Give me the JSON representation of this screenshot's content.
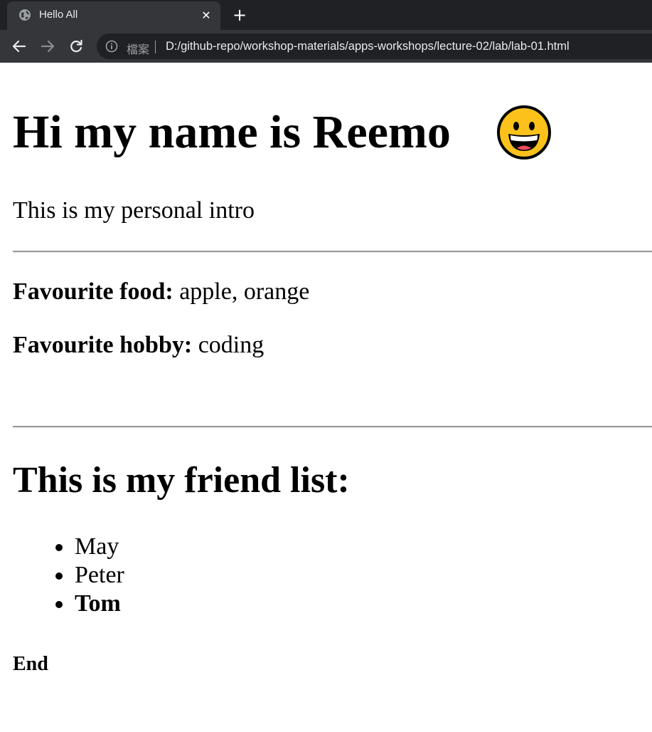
{
  "browser": {
    "tab": {
      "title": "Hello All",
      "favicon": "globe-icon",
      "close_icon": "✕"
    },
    "new_tab_icon": "+",
    "toolbar": {
      "back_icon": "arrow-left-icon",
      "forward_icon": "arrow-right-icon",
      "reload_icon": "reload-icon",
      "security_icon": "info-icon",
      "security_label": "檔案",
      "url": "D:/github-repo/workshop-materials/apps-workshops/lecture-02/lab/lab-01.html"
    },
    "colors": {
      "tabstrip": "#202124",
      "toolbar": "#35363a",
      "omnibox": "#202124"
    }
  },
  "page": {
    "heading": "Hi my name is Reemo",
    "heading_emoji": "grinning-face-icon",
    "intro": "This is my personal intro",
    "favourites": [
      {
        "label": "Favourite food:",
        "value": " apple, orange"
      },
      {
        "label": "Favourite hobby:",
        "value": " coding"
      }
    ],
    "friend_heading": "This is my friend list:",
    "friends": [
      {
        "name": "May",
        "bold": false
      },
      {
        "name": "Peter",
        "bold": false
      },
      {
        "name": "Tom",
        "bold": true
      }
    ],
    "end": "End"
  }
}
